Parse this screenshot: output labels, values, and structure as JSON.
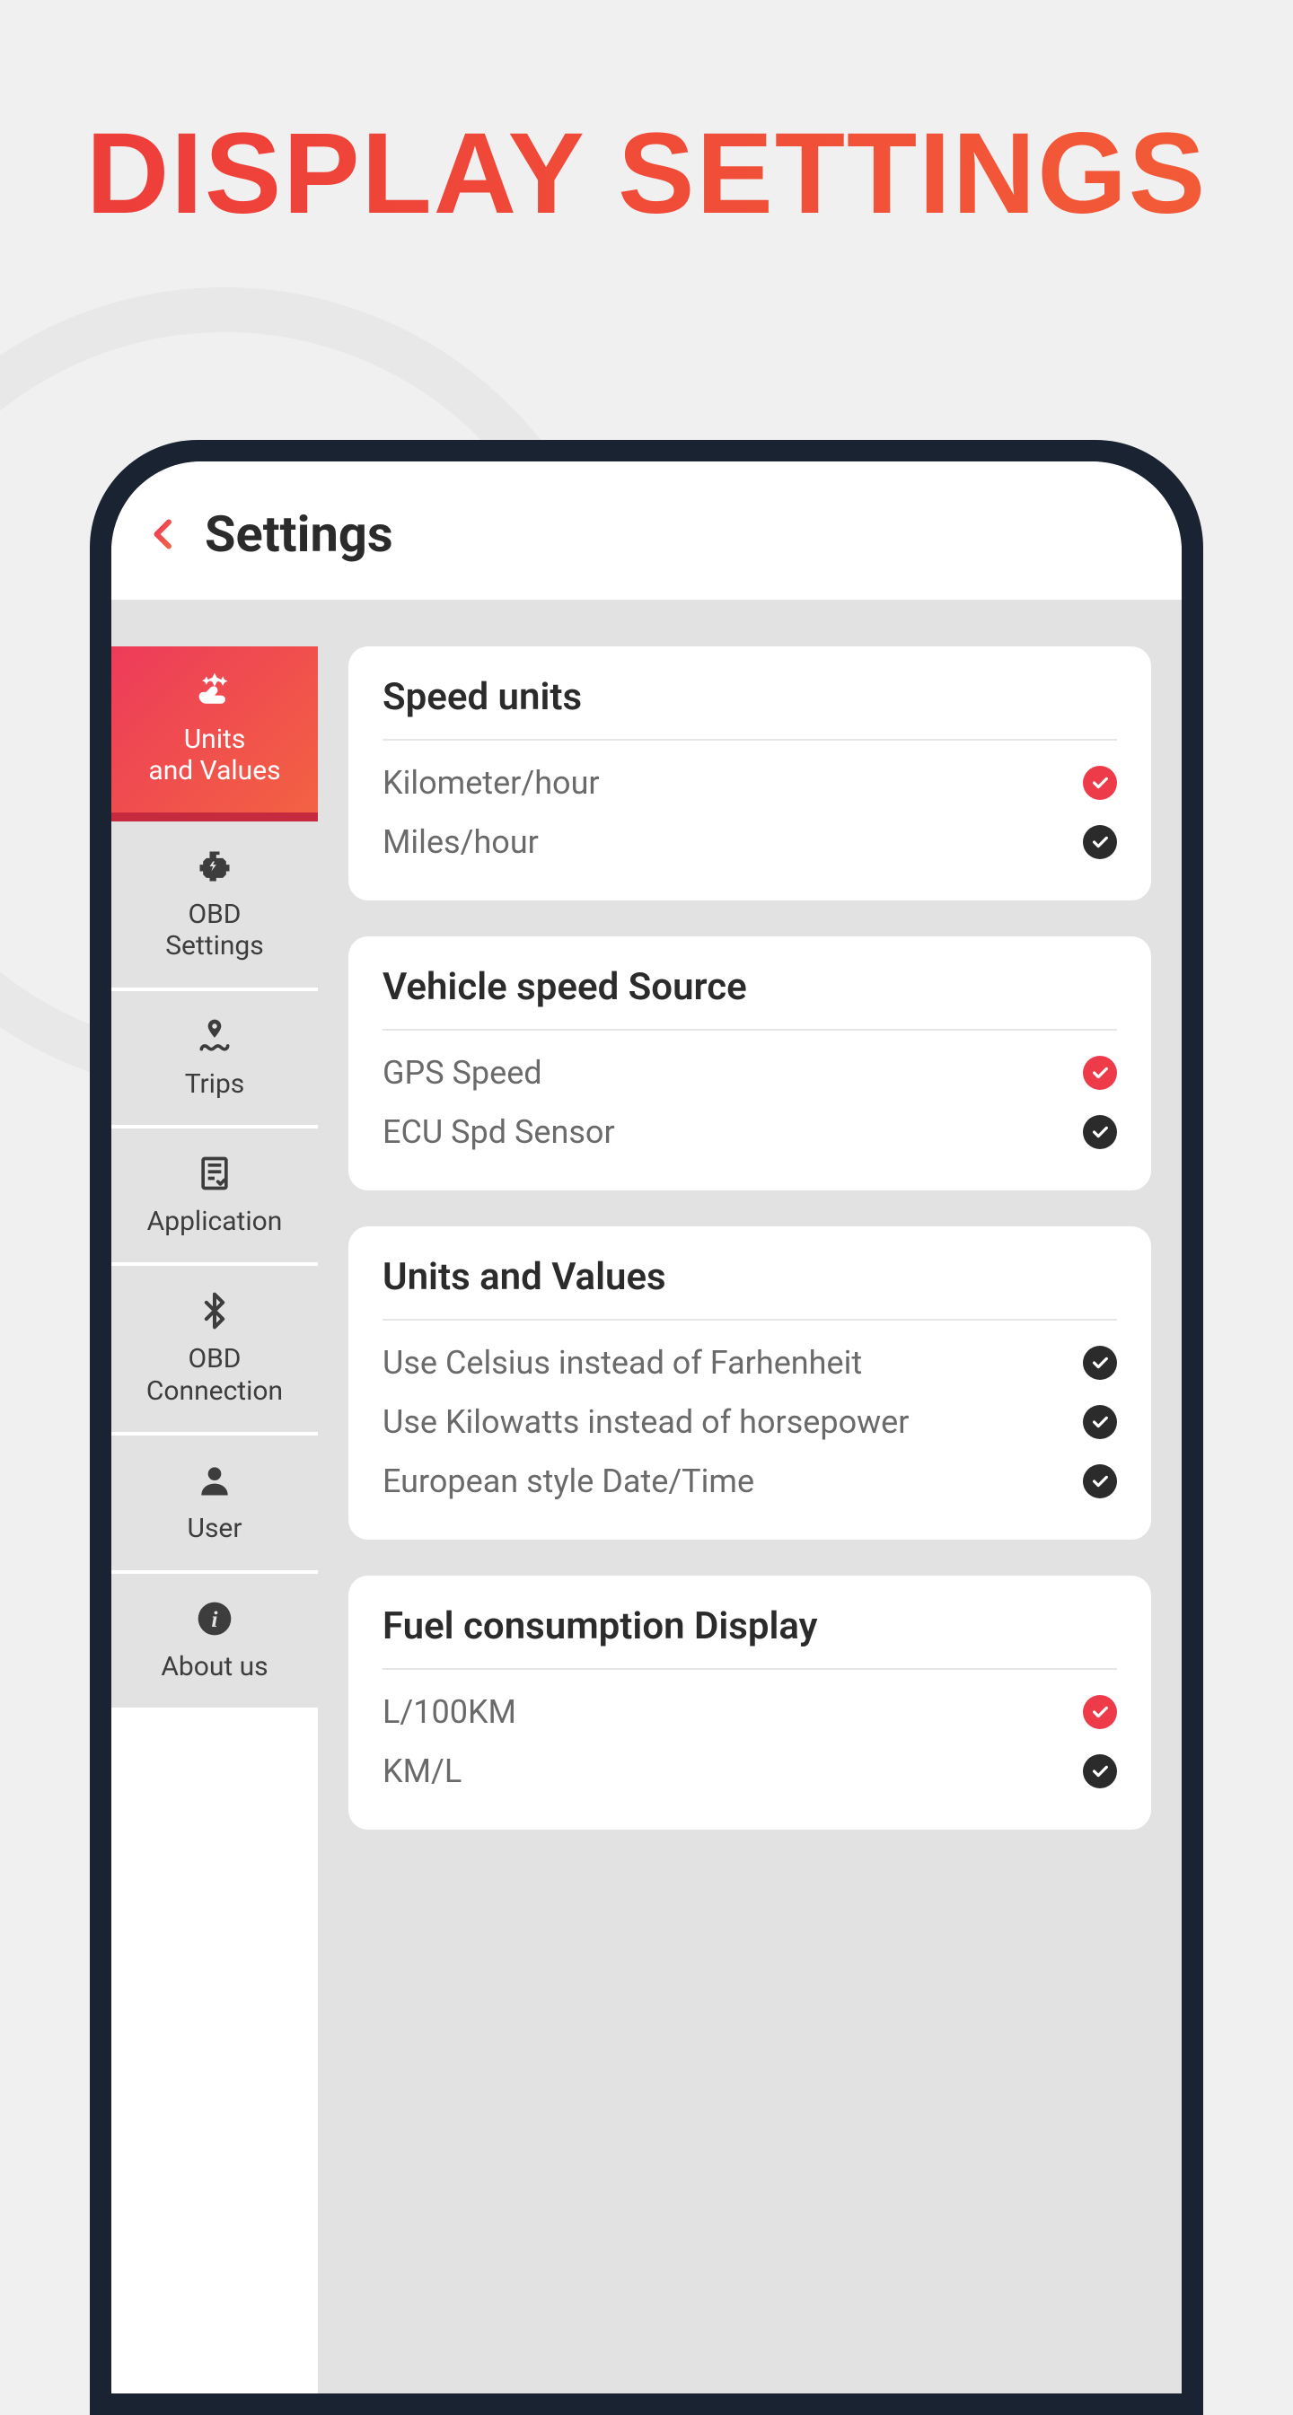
{
  "page_title": "DISPLAY SETTINGS",
  "header": {
    "title": "Settings"
  },
  "sidebar": {
    "items": [
      {
        "label": "Units\nand Values",
        "icon": "sparkle-hand-icon",
        "active": true
      },
      {
        "label": "OBD\nSettings",
        "icon": "engine-icon",
        "active": false
      },
      {
        "label": "Trips",
        "icon": "route-pin-icon",
        "active": false
      },
      {
        "label": "Application",
        "icon": "document-check-icon",
        "active": false
      },
      {
        "label": "OBD\nConnection",
        "icon": "bluetooth-icon",
        "active": false
      },
      {
        "label": "User",
        "icon": "person-icon",
        "active": false
      },
      {
        "label": "About us",
        "icon": "info-icon",
        "active": false
      }
    ]
  },
  "cards": [
    {
      "title": "Speed units",
      "options": [
        {
          "label": "Kilometer/hour",
          "selected": true
        },
        {
          "label": "Miles/hour",
          "selected": false
        }
      ]
    },
    {
      "title": "Vehicle speed Source",
      "options": [
        {
          "label": "GPS Speed",
          "selected": true
        },
        {
          "label": "ECU Spd Sensor",
          "selected": false
        }
      ]
    },
    {
      "title": "Units and Values",
      "options": [
        {
          "label": "Use Celsius instead of Farhenheit",
          "selected": false
        },
        {
          "label": "Use Kilowatts instead of horsepower",
          "selected": false
        },
        {
          "label": "European style Date/Time",
          "selected": false
        }
      ]
    },
    {
      "title": "Fuel consumption Display",
      "options": [
        {
          "label": "L/100KM",
          "selected": true
        },
        {
          "label": "KM/L",
          "selected": false
        }
      ]
    }
  ],
  "colors": {
    "accent": "#ed3b4a",
    "dark": "#2b2b2b"
  }
}
